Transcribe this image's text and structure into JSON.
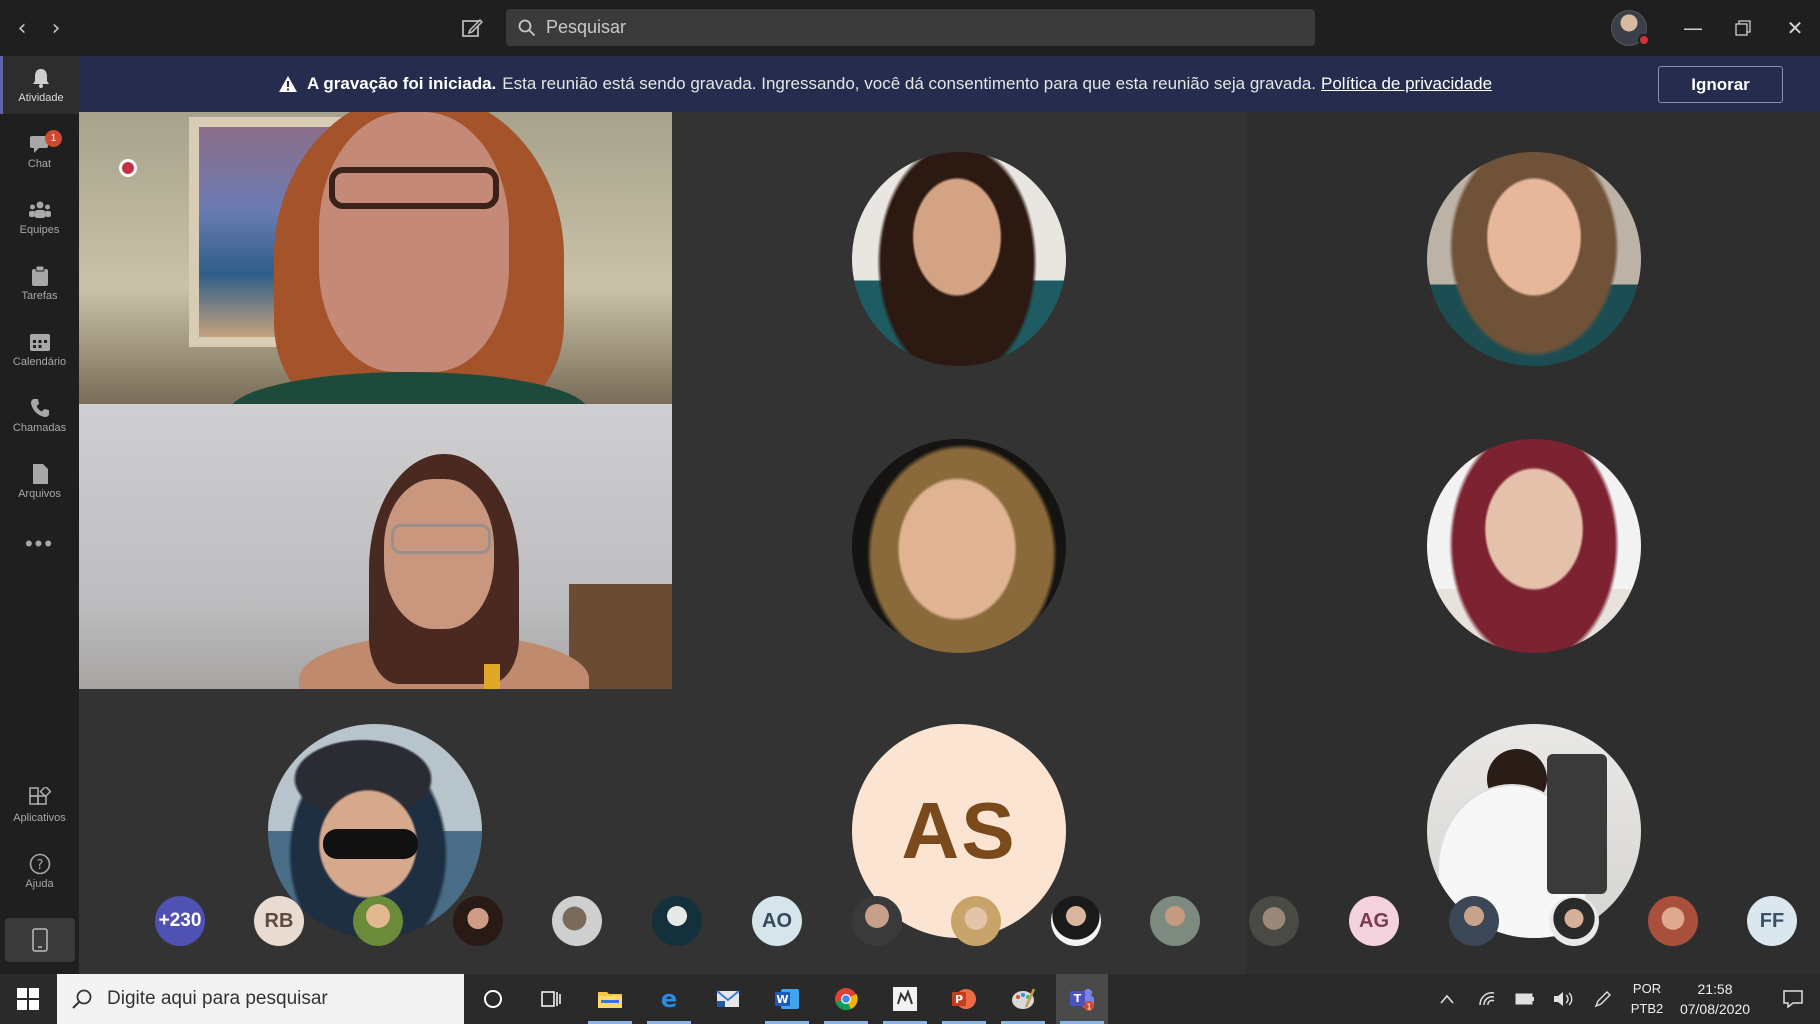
{
  "titlebar": {
    "search_placeholder": "Pesquisar"
  },
  "rail": {
    "items": [
      {
        "label": "Atividade",
        "icon": "bell-icon"
      },
      {
        "label": "Chat",
        "icon": "chat-icon",
        "badge": "1"
      },
      {
        "label": "Equipes",
        "icon": "teams-icon"
      },
      {
        "label": "Tarefas",
        "icon": "assignments-icon"
      },
      {
        "label": "Calendário",
        "icon": "calendar-icon"
      },
      {
        "label": "Chamadas",
        "icon": "phone-icon"
      },
      {
        "label": "Arquivos",
        "icon": "files-icon"
      },
      {
        "label": "Aplicativos",
        "icon": "apps-icon"
      },
      {
        "label": "Ajuda",
        "icon": "help-icon"
      }
    ],
    "more": "•••"
  },
  "banner": {
    "bold": "A gravação foi iniciada.",
    "text": "Esta reunião está sendo gravada. Ingressando, você dá consentimento para que esta reunião seja gravada.",
    "link": "Política de privacidade",
    "button": "Ignorar"
  },
  "grid": {
    "big_initials": "AS"
  },
  "strip": {
    "more_count": "+230",
    "initials": [
      "RB",
      "AO",
      "AG",
      "FF"
    ]
  },
  "taskbar": {
    "search_placeholder": "Digite aqui para pesquisar",
    "lang_top": "POR",
    "lang_bottom": "PTB2",
    "time": "21:58",
    "date": "07/08/2020",
    "teams_badge": "1"
  },
  "colors": {
    "accent": "#6264a7",
    "banner_bg": "#252c4d",
    "recording": "#c4314b",
    "badge": "#cc4a31"
  }
}
